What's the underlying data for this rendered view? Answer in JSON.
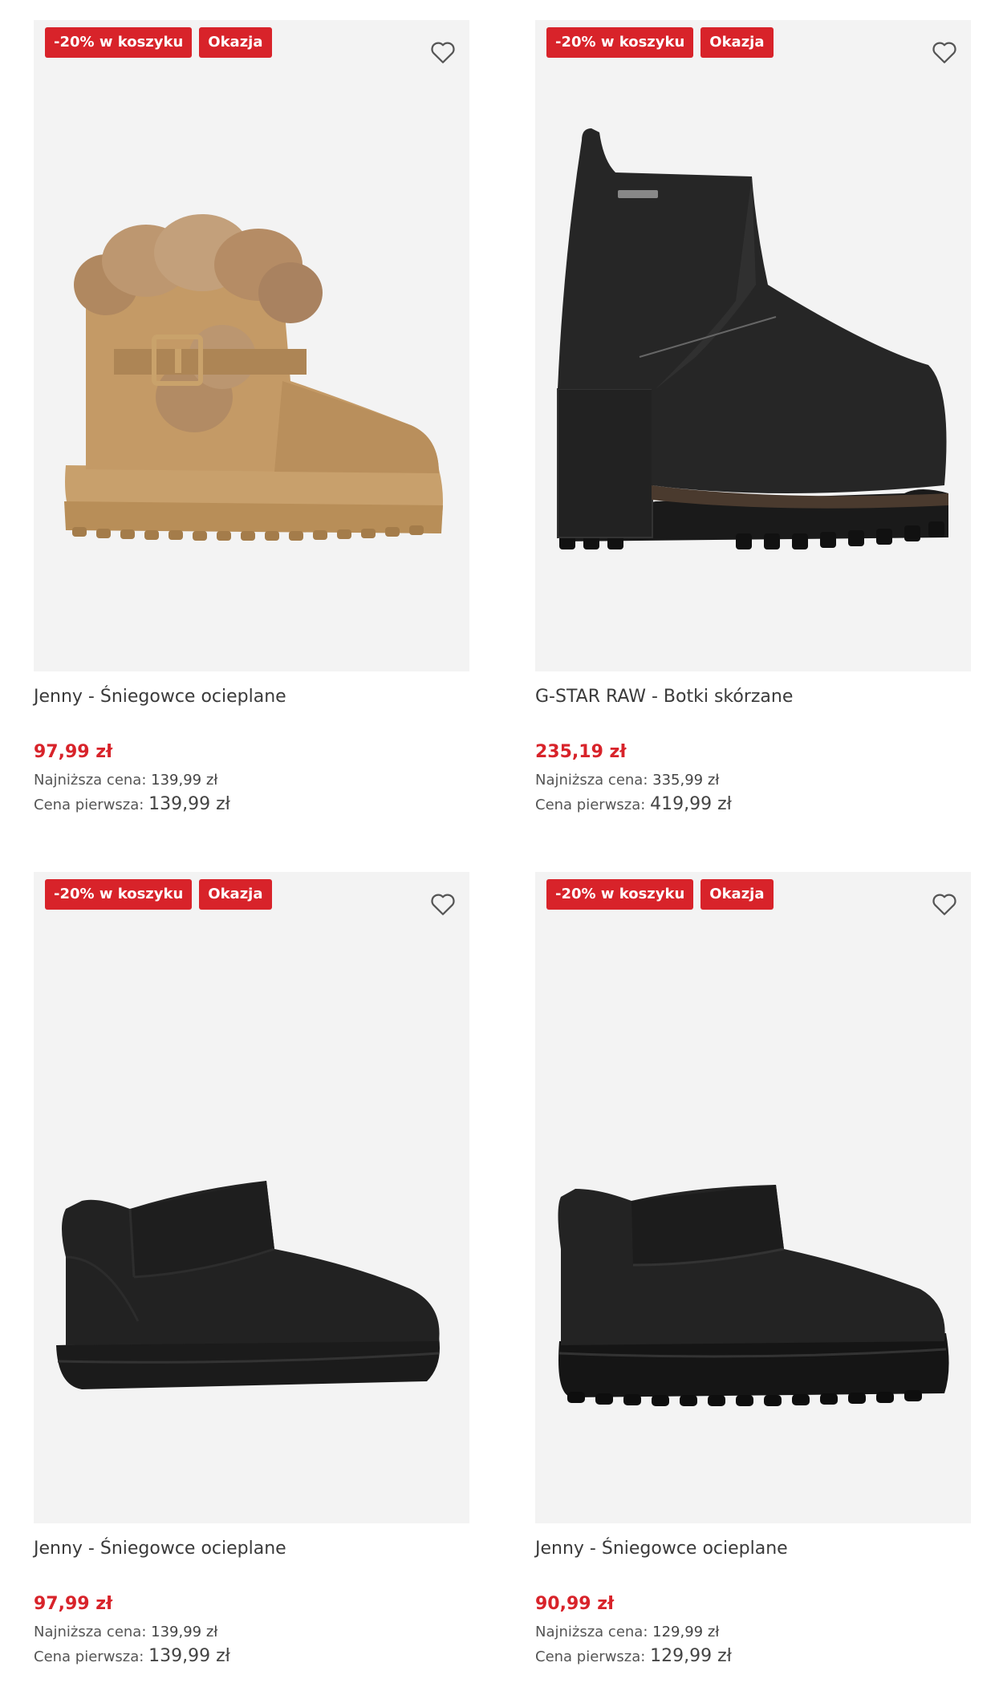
{
  "products": [
    {
      "badges": [
        "-20% w koszyku",
        "Okazja"
      ],
      "name": "Jenny - Śniegowce ocieplane",
      "price": "97,99 zł",
      "lowest_label": "Najniższa cena:",
      "lowest_value": "139,99 zł",
      "first_label": "Cena pierwsza:",
      "first_value": "139,99 zł"
    },
    {
      "badges": [
        "-20% w koszyku",
        "Okazja"
      ],
      "name": "G-STAR RAW - Botki skórzane",
      "price": "235,19 zł",
      "lowest_label": "Najniższa cena:",
      "lowest_value": "335,99 zł",
      "first_label": "Cena pierwsza:",
      "first_value": "419,99 zł"
    },
    {
      "badges": [
        "-20% w koszyku",
        "Okazja"
      ],
      "name": "Jenny - Śniegowce ocieplane",
      "price": "97,99 zł",
      "lowest_label": "Najniższa cena:",
      "lowest_value": "139,99 zł",
      "first_label": "Cena pierwsza:",
      "first_value": "139,99 zł"
    },
    {
      "badges": [
        "-20% w koszyku",
        "Okazja"
      ],
      "name": "Jenny - Śniegowce ocieplane",
      "price": "90,99 zł",
      "lowest_label": "Najniższa cena:",
      "lowest_value": "129,99 zł",
      "first_label": "Cena pierwsza:",
      "first_value": "129,99 zł"
    }
  ],
  "icons": {
    "favorite": "heart-outline-icon"
  },
  "colors": {
    "badge": "#d8232a",
    "price": "#d8232a",
    "image_bg": "#f3f3f3"
  }
}
